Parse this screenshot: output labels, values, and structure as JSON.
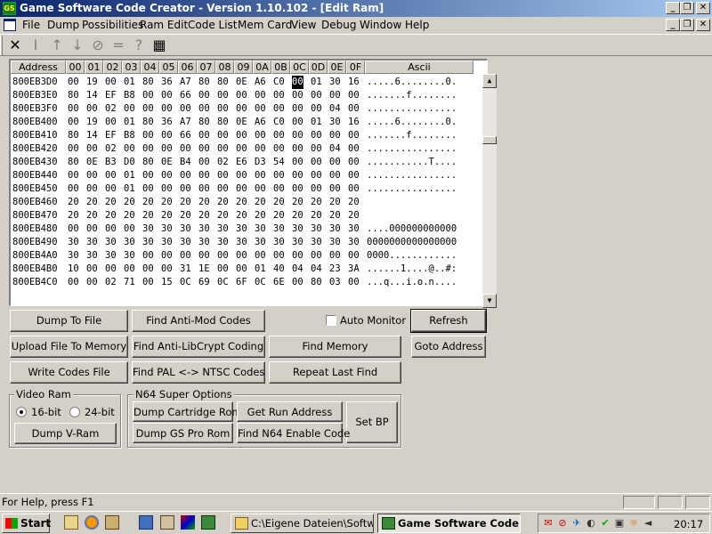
{
  "window": {
    "title": "Game Software Code Creator - Version 1.10.102 - [Edit Ram]",
    "app_icon_text": "GS"
  },
  "menu": [
    "File",
    "Dump",
    "Possibilities",
    "Ram Edit",
    "Code List",
    "Mem Card",
    "View",
    "Debug",
    "Window",
    "Help"
  ],
  "toolbar_icons": [
    "cross-arrows-icon",
    "text-cursor-icon",
    "arrow-up-icon",
    "arrow-down-icon",
    "no-entry-icon",
    "equals-icon",
    "question-icon",
    "calculator-icon"
  ],
  "hex_editor": {
    "address_header": "Address",
    "column_headers": [
      "00",
      "01",
      "02",
      "03",
      "04",
      "05",
      "06",
      "07",
      "08",
      "09",
      "0A",
      "0B",
      "0C",
      "0D",
      "0E",
      "0F"
    ],
    "ascii_header": "Ascii",
    "selected_row": 0,
    "selected_col": 12,
    "rows": [
      {
        "addr": "800EB3D0",
        "bytes": [
          "00",
          "19",
          "00",
          "01",
          "80",
          "36",
          "A7",
          "80",
          "80",
          "0E",
          "A6",
          "C0",
          "00",
          "01",
          "30",
          "16"
        ],
        "ascii": ".....6........0."
      },
      {
        "addr": "800EB3E0",
        "bytes": [
          "80",
          "14",
          "EF",
          "B8",
          "00",
          "00",
          "66",
          "00",
          "00",
          "00",
          "00",
          "00",
          "00",
          "00",
          "00",
          "00"
        ],
        "ascii": ".......f........"
      },
      {
        "addr": "800EB3F0",
        "bytes": [
          "00",
          "00",
          "02",
          "00",
          "00",
          "00",
          "00",
          "00",
          "00",
          "00",
          "00",
          "00",
          "00",
          "00",
          "04",
          "00"
        ],
        "ascii": "................"
      },
      {
        "addr": "800EB400",
        "bytes": [
          "00",
          "19",
          "00",
          "01",
          "80",
          "36",
          "A7",
          "80",
          "80",
          "0E",
          "A6",
          "C0",
          "00",
          "01",
          "30",
          "16"
        ],
        "ascii": ".....6........0."
      },
      {
        "addr": "800EB410",
        "bytes": [
          "80",
          "14",
          "EF",
          "B8",
          "00",
          "00",
          "66",
          "00",
          "00",
          "00",
          "00",
          "00",
          "00",
          "00",
          "00",
          "00"
        ],
        "ascii": ".......f........"
      },
      {
        "addr": "800EB420",
        "bytes": [
          "00",
          "00",
          "02",
          "00",
          "00",
          "00",
          "00",
          "00",
          "00",
          "00",
          "00",
          "00",
          "00",
          "00",
          "04",
          "00"
        ],
        "ascii": "................"
      },
      {
        "addr": "800EB430",
        "bytes": [
          "80",
          "0E",
          "B3",
          "D0",
          "80",
          "0E",
          "B4",
          "00",
          "02",
          "E6",
          "D3",
          "54",
          "00",
          "00",
          "00",
          "00"
        ],
        "ascii": "...........T...."
      },
      {
        "addr": "800EB440",
        "bytes": [
          "00",
          "00",
          "00",
          "01",
          "00",
          "00",
          "00",
          "00",
          "00",
          "00",
          "00",
          "00",
          "00",
          "00",
          "00",
          "00"
        ],
        "ascii": "................"
      },
      {
        "addr": "800EB450",
        "bytes": [
          "00",
          "00",
          "00",
          "01",
          "00",
          "00",
          "00",
          "00",
          "00",
          "00",
          "00",
          "00",
          "00",
          "00",
          "00",
          "00"
        ],
        "ascii": "................"
      },
      {
        "addr": "800EB460",
        "bytes": [
          "20",
          "20",
          "20",
          "20",
          "20",
          "20",
          "20",
          "20",
          "20",
          "20",
          "20",
          "20",
          "20",
          "20",
          "20",
          "20"
        ],
        "ascii": ""
      },
      {
        "addr": "800EB470",
        "bytes": [
          "20",
          "20",
          "20",
          "20",
          "20",
          "20",
          "20",
          "20",
          "20",
          "20",
          "20",
          "20",
          "20",
          "20",
          "20",
          "20"
        ],
        "ascii": ""
      },
      {
        "addr": "800EB480",
        "bytes": [
          "00",
          "00",
          "00",
          "00",
          "30",
          "30",
          "30",
          "30",
          "30",
          "30",
          "30",
          "30",
          "30",
          "30",
          "30",
          "30"
        ],
        "ascii": "....000000000000"
      },
      {
        "addr": "800EB490",
        "bytes": [
          "30",
          "30",
          "30",
          "30",
          "30",
          "30",
          "30",
          "30",
          "30",
          "30",
          "30",
          "30",
          "30",
          "30",
          "30",
          "30"
        ],
        "ascii": "0000000000000000"
      },
      {
        "addr": "800EB4A0",
        "bytes": [
          "30",
          "30",
          "30",
          "30",
          "00",
          "00",
          "00",
          "00",
          "00",
          "00",
          "00",
          "00",
          "00",
          "00",
          "00",
          "00"
        ],
        "ascii": "0000............"
      },
      {
        "addr": "800EB4B0",
        "bytes": [
          "10",
          "00",
          "00",
          "00",
          "00",
          "00",
          "31",
          "1E",
          "00",
          "00",
          "01",
          "40",
          "04",
          "04",
          "23",
          "3A"
        ],
        "ascii": "......1....@..#:"
      },
      {
        "addr": "800EB4C0",
        "bytes": [
          "00",
          "00",
          "02",
          "71",
          "00",
          "15",
          "0C",
          "69",
          "0C",
          "6F",
          "0C",
          "6E",
          "00",
          "80",
          "03",
          "00"
        ],
        "ascii": "...q...i.o.n...."
      }
    ]
  },
  "buttons": {
    "dump_to_file": "Dump To File",
    "find_anti_mod": "Find Anti-Mod Codes",
    "auto_monitor": "Auto Monitor",
    "refresh": "Refresh",
    "upload_file": "Upload File To Memory",
    "find_anti_libcrypt": "Find Anti-LibCrypt Coding",
    "find_memory": "Find Memory",
    "goto_address": "Goto Address",
    "write_codes": "Write Codes File",
    "find_pal_ntsc": "Find PAL <-> NTSC Codes",
    "repeat_last_find": "Repeat Last Find"
  },
  "video_ram": {
    "title": "Video Ram",
    "opt_16": "16-bit",
    "opt_24": "24-bit",
    "selected": "16-bit",
    "dump_vram": "Dump V-Ram"
  },
  "n64": {
    "title": "N64 Super Options",
    "dump_cart": "Dump Cartridge Rom",
    "get_run": "Get Run Address",
    "set_bp": "Set BP",
    "dump_gs": "Dump GS Pro Rom",
    "find_enable": "Find N64 Enable Code"
  },
  "status": {
    "text": "For Help, press F1"
  },
  "taskbar": {
    "start": "Start",
    "task1": "C:\\Eigene Dateien\\Softw...",
    "task2": "Game Software Code ...",
    "clock": "20:17"
  },
  "colors": {
    "title_start": "#0a246a",
    "title_end": "#a6caf0",
    "face": "#d4d0c8"
  }
}
